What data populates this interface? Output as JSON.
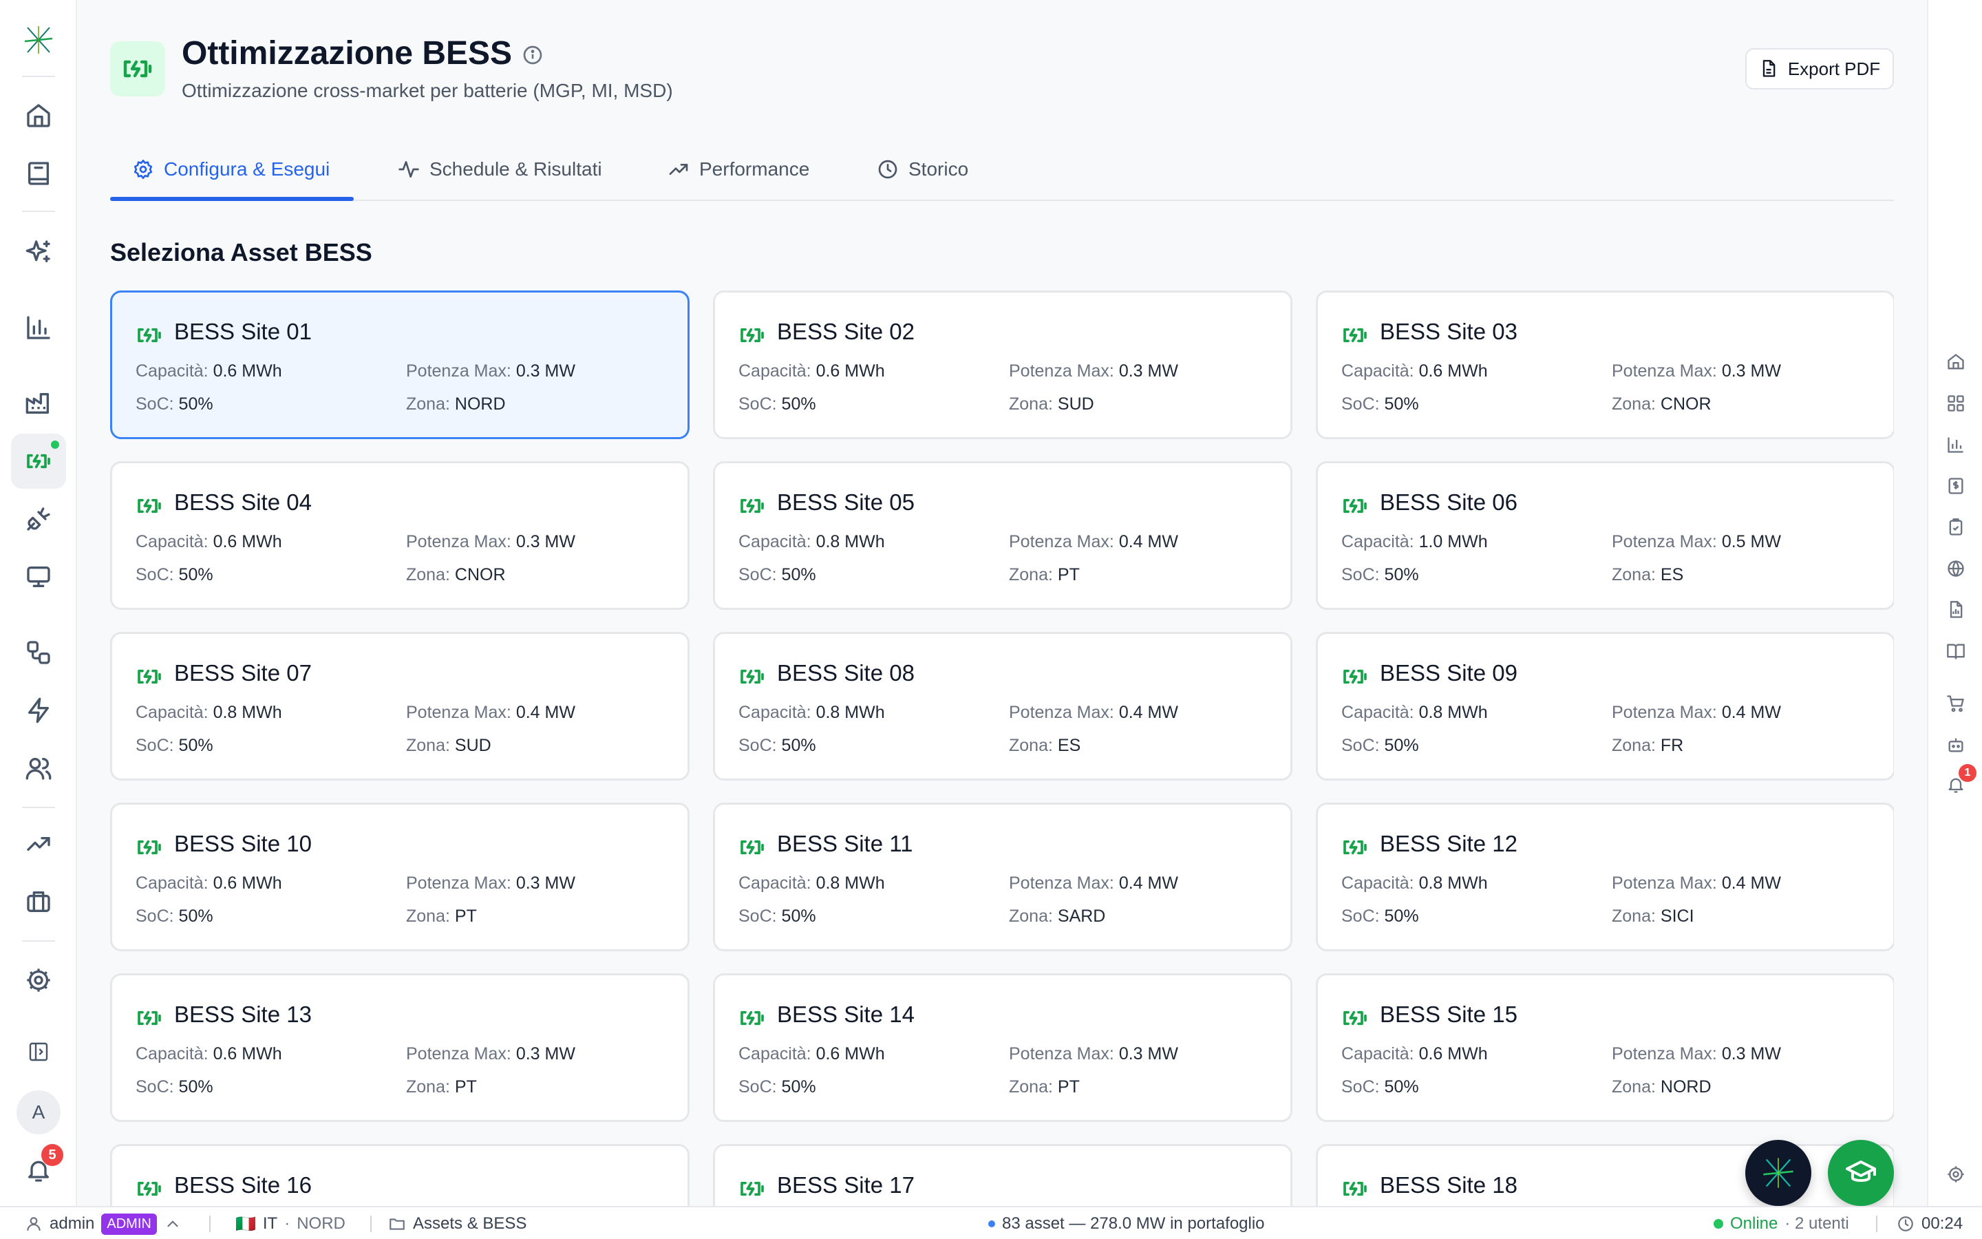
{
  "header": {
    "title": "Ottimizzazione BESS",
    "subtitle": "Ottimizzazione cross-market per batterie (MGP, MI, MSD)",
    "export_label": "Export PDF",
    "accent_color": "#16a34a"
  },
  "tabs": [
    {
      "label": "Configura & Esegui",
      "icon": "gear-icon",
      "active": true
    },
    {
      "label": "Schedule & Risultati",
      "icon": "activity-icon",
      "active": false
    },
    {
      "label": "Performance",
      "icon": "trending-up-icon",
      "active": false
    },
    {
      "label": "Storico",
      "icon": "clock-icon",
      "active": false
    }
  ],
  "section_title": "Seleziona Asset BESS",
  "field_labels": {
    "capacity": "Capacità:",
    "power": "Potenza Max:",
    "soc": "SoC:",
    "zone": "Zona:"
  },
  "assets": [
    {
      "name": "BESS Site 01",
      "capacity": "0.6 MWh",
      "power": "0.3 MW",
      "soc": "50%",
      "zone": "NORD",
      "selected": true
    },
    {
      "name": "BESS Site 02",
      "capacity": "0.6 MWh",
      "power": "0.3 MW",
      "soc": "50%",
      "zone": "SUD"
    },
    {
      "name": "BESS Site 03",
      "capacity": "0.6 MWh",
      "power": "0.3 MW",
      "soc": "50%",
      "zone": "CNOR"
    },
    {
      "name": "BESS Site 04",
      "capacity": "0.6 MWh",
      "power": "0.3 MW",
      "soc": "50%",
      "zone": "CNOR"
    },
    {
      "name": "BESS Site 05",
      "capacity": "0.8 MWh",
      "power": "0.4 MW",
      "soc": "50%",
      "zone": "PT"
    },
    {
      "name": "BESS Site 06",
      "capacity": "1.0 MWh",
      "power": "0.5 MW",
      "soc": "50%",
      "zone": "ES"
    },
    {
      "name": "BESS Site 07",
      "capacity": "0.8 MWh",
      "power": "0.4 MW",
      "soc": "50%",
      "zone": "SUD"
    },
    {
      "name": "BESS Site 08",
      "capacity": "0.8 MWh",
      "power": "0.4 MW",
      "soc": "50%",
      "zone": "ES"
    },
    {
      "name": "BESS Site 09",
      "capacity": "0.8 MWh",
      "power": "0.4 MW",
      "soc": "50%",
      "zone": "FR"
    },
    {
      "name": "BESS Site 10",
      "capacity": "0.6 MWh",
      "power": "0.3 MW",
      "soc": "50%",
      "zone": "PT"
    },
    {
      "name": "BESS Site 11",
      "capacity": "0.8 MWh",
      "power": "0.4 MW",
      "soc": "50%",
      "zone": "SARD"
    },
    {
      "name": "BESS Site 12",
      "capacity": "0.8 MWh",
      "power": "0.4 MW",
      "soc": "50%",
      "zone": "SICI"
    },
    {
      "name": "BESS Site 13",
      "capacity": "0.6 MWh",
      "power": "0.3 MW",
      "soc": "50%",
      "zone": "PT"
    },
    {
      "name": "BESS Site 14",
      "capacity": "0.6 MWh",
      "power": "0.3 MW",
      "soc": "50%",
      "zone": "PT"
    },
    {
      "name": "BESS Site 15",
      "capacity": "0.6 MWh",
      "power": "0.3 MW",
      "soc": "50%",
      "zone": "NORD"
    },
    {
      "name": "BESS Site 16"
    },
    {
      "name": "BESS Site 17"
    },
    {
      "name": "BESS Site 18"
    }
  ],
  "left_nav": {
    "icons": [
      "home-icon",
      "book-icon",
      "sparkles-icon",
      "bar-chart-icon",
      "factory-icon",
      "battery-charging-icon",
      "plug-icon",
      "monitor-icon",
      "workflow-icon",
      "zap-icon",
      "users-icon",
      "trending-up-icon",
      "briefcase-icon",
      "settings-icon",
      "sidebar-toggle-icon"
    ],
    "avatar_letter": "A",
    "notifications_count": "5"
  },
  "right_nav": {
    "icons": [
      "home-icon",
      "grid-icon",
      "bar-chart-icon",
      "dollar-icon",
      "clipboard-icon",
      "globe-icon",
      "file-chart-icon",
      "book-open-icon",
      "cart-icon",
      "bot-icon",
      "bell-icon",
      "settings-icon"
    ],
    "notifications_count": "1"
  },
  "status_bar": {
    "user": "admin",
    "role": "ADMIN",
    "flag": "🇮🇹",
    "country": "IT",
    "zone": "NORD",
    "section": "Assets & BESS",
    "portfolio": "83 asset — 278.0 MW in portafoglio",
    "online": "Online",
    "users": "· 2 utenti",
    "time": "00:24"
  }
}
